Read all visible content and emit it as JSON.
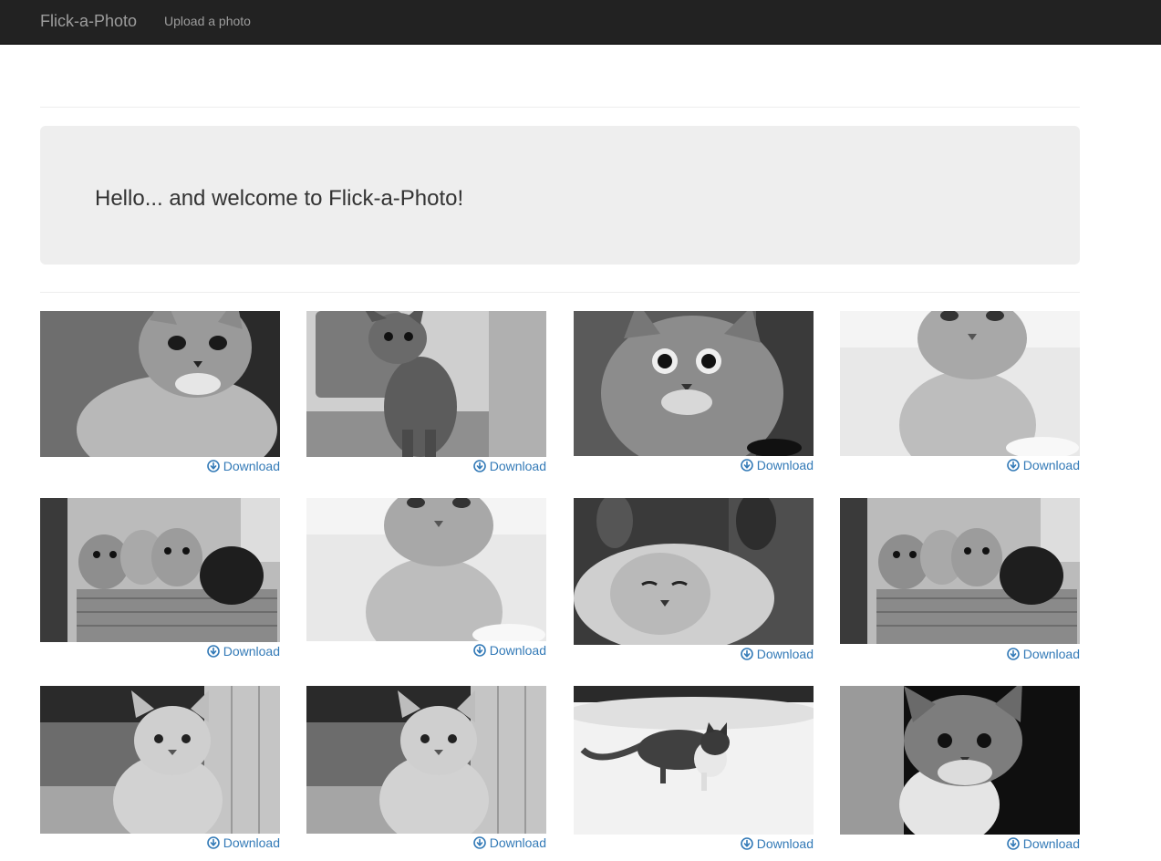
{
  "navbar": {
    "brand": "Flick-a-Photo",
    "links": [
      {
        "label": "Upload a photo"
      }
    ],
    "background": "#222222",
    "text_color": "#9d9d9d"
  },
  "jumbotron": {
    "heading": "Hello... and welcome to Flick-a-Photo!",
    "background": "#eeeeee"
  },
  "gallery": {
    "link_color": "#337ab7",
    "download_icon": "circle-arrow-down-icon",
    "photos": [
      {
        "subject": "kitten-closeup-grey",
        "download_label": "Download"
      },
      {
        "subject": "tabby-kitten-by-pot",
        "download_label": "Download"
      },
      {
        "subject": "fluffy-kitten-face",
        "download_label": "Download"
      },
      {
        "subject": "white-kitten-bright",
        "download_label": "Download"
      },
      {
        "subject": "four-kittens-basket",
        "download_label": "Download"
      },
      {
        "subject": "white-kitten-bright",
        "download_label": "Download"
      },
      {
        "subject": "kitten-stretching-paws",
        "download_label": "Download"
      },
      {
        "subject": "four-kittens-basket",
        "download_label": "Download"
      },
      {
        "subject": "kitten-by-wooden-door",
        "download_label": "Download"
      },
      {
        "subject": "kitten-by-wooden-door",
        "download_label": "Download"
      },
      {
        "subject": "kitten-walking-in-snow",
        "download_label": "Download"
      },
      {
        "subject": "kitten-peeking-over-edge",
        "download_label": "Download"
      }
    ]
  }
}
